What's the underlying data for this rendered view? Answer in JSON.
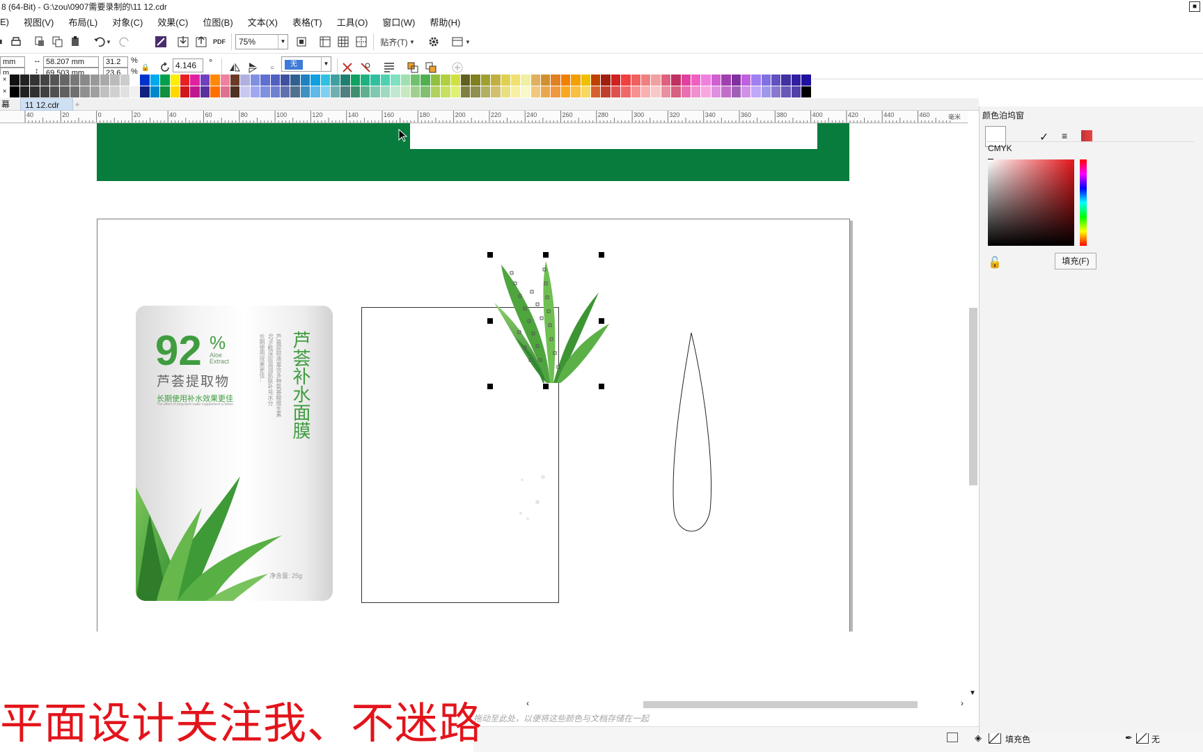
{
  "window": {
    "title": "8 (64-Bit) - G:\\zou\\0907需要录制的\\11 12.cdr"
  },
  "menu": [
    {
      "label": "E)"
    },
    {
      "label": "视图(V)"
    },
    {
      "label": "布局(L)"
    },
    {
      "label": "对象(C)"
    },
    {
      "label": "效果(C)"
    },
    {
      "label": "位图(B)"
    },
    {
      "label": "文本(X)"
    },
    {
      "label": "表格(T)"
    },
    {
      "label": "工具(O)"
    },
    {
      "label": "窗口(W)"
    },
    {
      "label": "帮助(H)"
    }
  ],
  "toolbar": {
    "zoom_value": "75%",
    "snap_label": "贴齐(T)"
  },
  "propbar": {
    "x_unit": "mm",
    "y_unit": "m",
    "width_value": "58.207 mm",
    "height_value": "69.503 mm",
    "scale_x": "31.2",
    "scale_y": "23.6",
    "percent_x": "%",
    "percent_y": "%",
    "rotation_value": "4.146",
    "rotation_unit": "°",
    "fill_none": "无"
  },
  "document": {
    "prev_tab_label": "幕",
    "active_tab_label": "11 12.cdr",
    "add_tab_label": "+"
  },
  "ruler": {
    "labels": [
      "40",
      "20",
      "0",
      "20",
      "40",
      "60",
      "80",
      "100",
      "120",
      "140",
      "160",
      "180",
      "200",
      "220",
      "240",
      "260",
      "280",
      "300",
      "320",
      "340",
      "360",
      "380",
      "400",
      "420",
      "440",
      "460"
    ],
    "unit_label": "毫米"
  },
  "artwork": {
    "percent_number": "92",
    "percent_sign": "%",
    "aloe_line1": "Aloe",
    "aloe_line2": "Extract",
    "extract_cn": "芦荟提取物",
    "benefit_cn": "长期使用补水效果更佳",
    "benefit_en": "The effect of long-term water supplement is better",
    "product_name": "芦荟补水面膜",
    "description_col1": "芦荟提取液富含多种氨基酸维生素",
    "description_col2": "92%能深层滋润肌肤补充水分",
    "description_col3": "长期使用效果更佳...",
    "net_weight": "净含量: 25g"
  },
  "docker": {
    "title": "颜色泊坞窗",
    "model": "CMYK",
    "fill_button": "填充(F)"
  },
  "status": {
    "hint": "拖动至此处，以便将这些颜色与文档存储在一起",
    "fill_label": "填充色",
    "outline_label": "无"
  },
  "caption": {
    "text": "平面设计关注我、不迷路"
  },
  "colors": {
    "green_band": "#077c3c",
    "aloe_green": "#3a9a3a",
    "caption_red": "#e3141b",
    "text_green": "#3f9c3f"
  }
}
